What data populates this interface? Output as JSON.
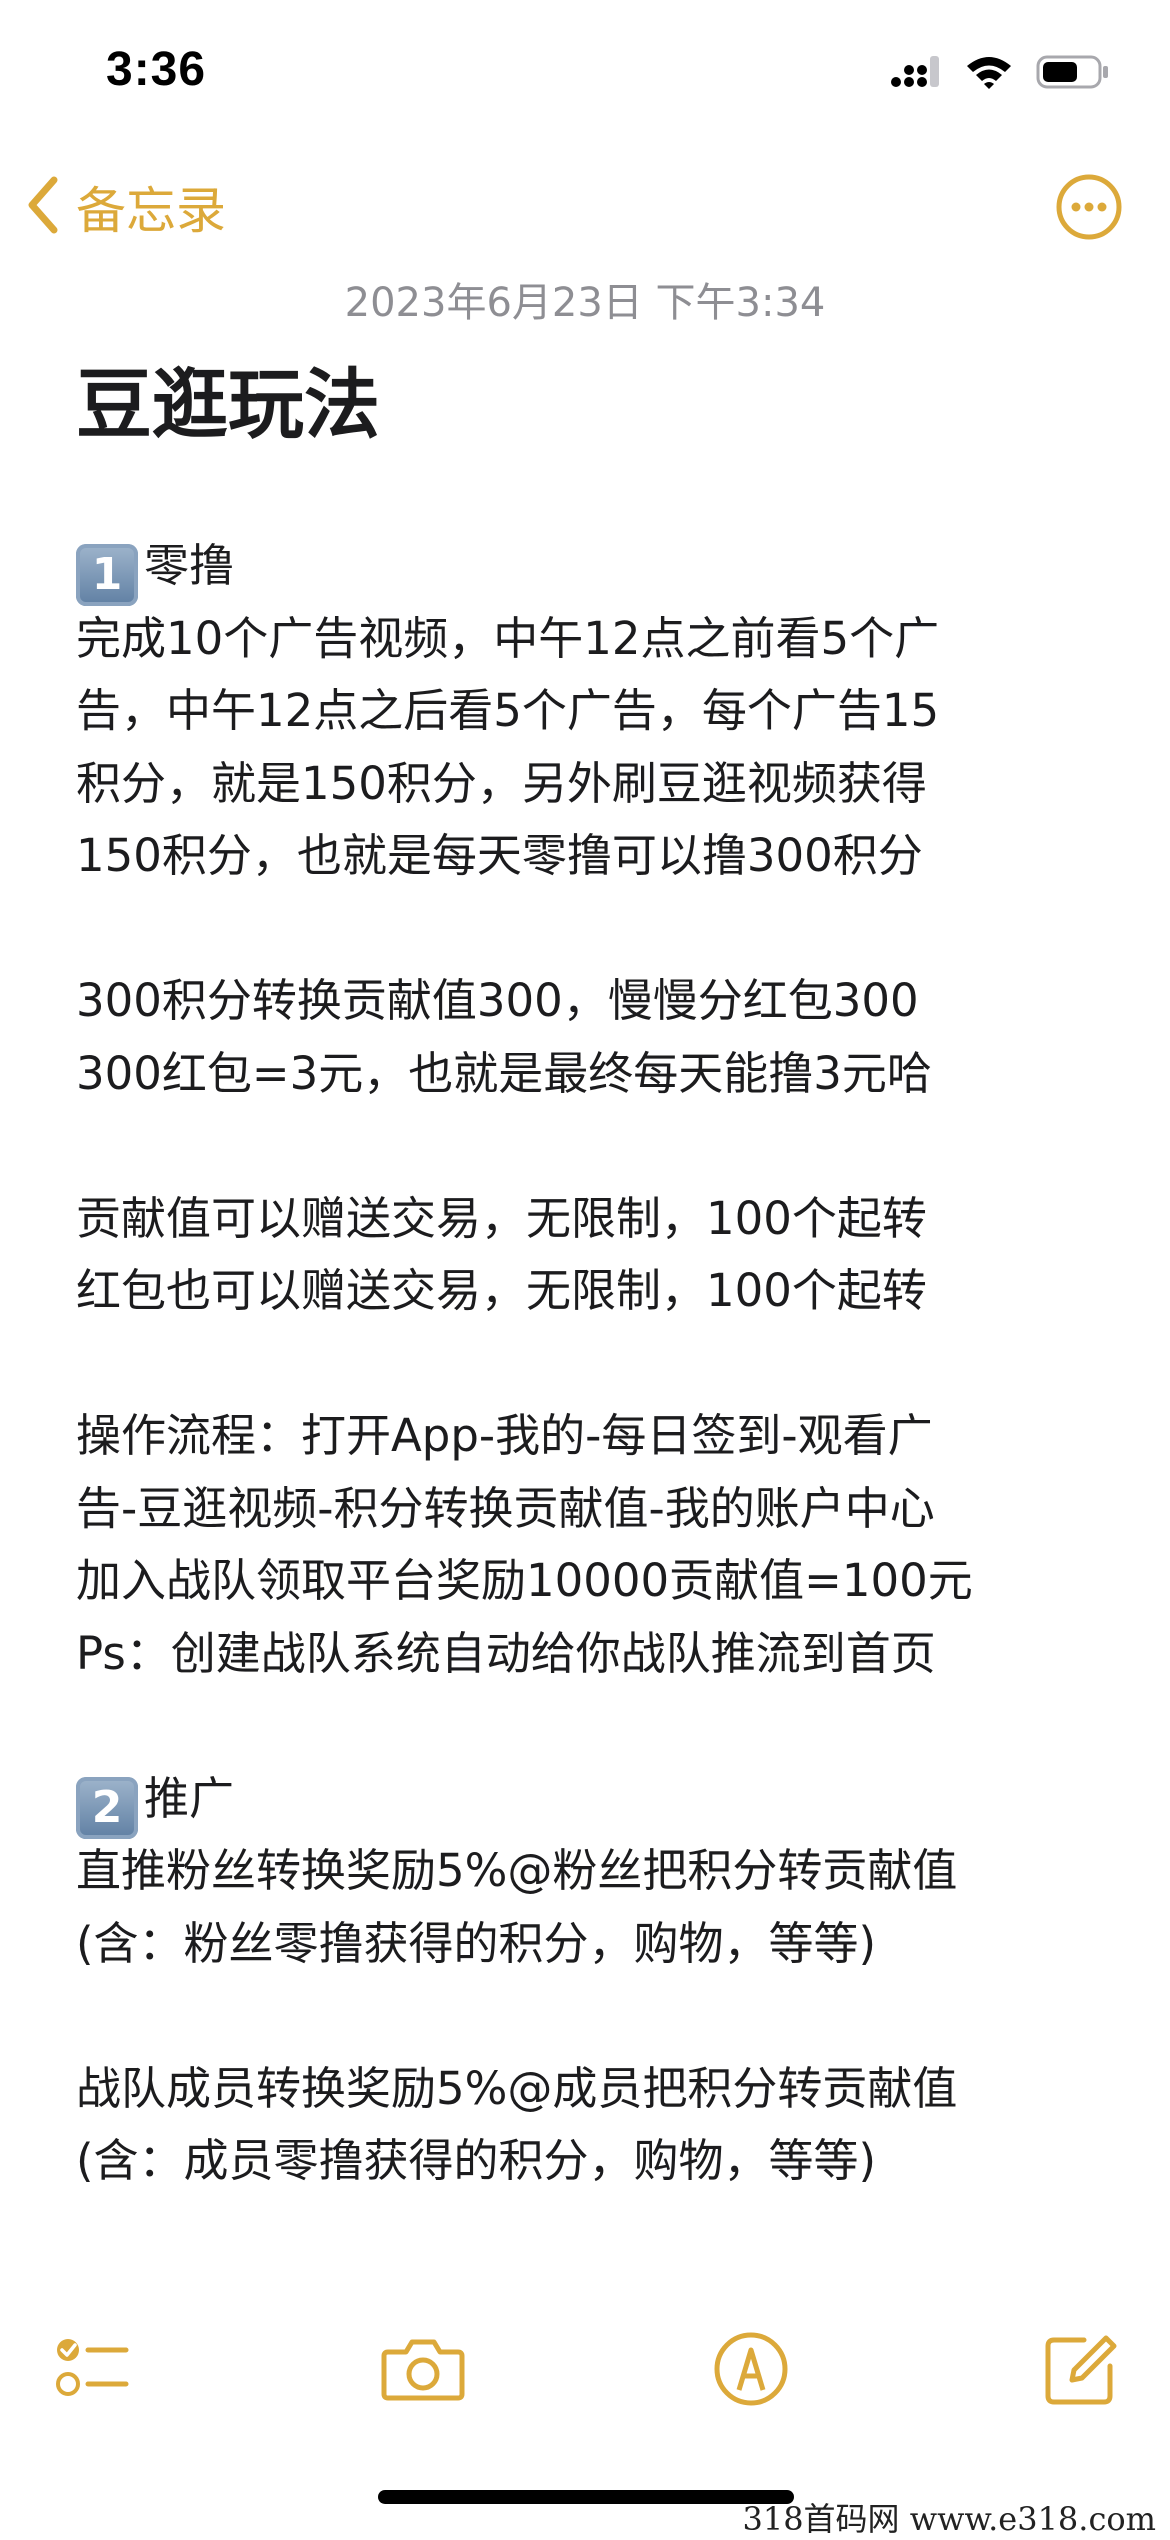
{
  "status_bar": {
    "time": "3:36"
  },
  "nav": {
    "back_label": "备忘录"
  },
  "note": {
    "date": "2023年6月23日 下午3:34",
    "title": "豆逛玩法",
    "lines": [
      {
        "badge": "1",
        "text": "零撸"
      },
      {
        "text": "完成10个广告视频，中午12点之前看5个广"
      },
      {
        "text": "告，中午12点之后看5个广告，每个广告15"
      },
      {
        "text": "积分，就是150积分，另外刷豆逛视频获得"
      },
      {
        "text": "150积分，也就是每天零撸可以撸300积分"
      },
      {
        "text": ""
      },
      {
        "text": "300积分转换贡献值300，慢慢分红包300"
      },
      {
        "text": "300红包=3元，也就是最终每天能撸3元哈"
      },
      {
        "text": ""
      },
      {
        "text": "贡献值可以赠送交易，无限制，100个起转"
      },
      {
        "text": "红包也可以赠送交易，无限制，100个起转"
      },
      {
        "text": ""
      },
      {
        "text": "操作流程：打开App-我的-每日签到-观看广"
      },
      {
        "text": "告-豆逛视频-积分转换贡献值-我的账户中心"
      },
      {
        "text": "加入战队领取平台奖励10000贡献值=100元"
      },
      {
        "text": "Ps：创建战队系统自动给你战队推流到首页"
      },
      {
        "text": ""
      },
      {
        "badge": "2",
        "text": "推广"
      },
      {
        "text": "直推粉丝转换奖励5%@粉丝把积分转贡献值"
      },
      {
        "text": "(含：粉丝零撸获得的积分，购物，等等)"
      },
      {
        "text": ""
      },
      {
        "text": "战队成员转换奖励5%@成员把积分转贡献值"
      },
      {
        "text": "(含：成员零撸获得的积分，购物，等等)"
      }
    ]
  },
  "toolbar": {
    "items": [
      "checklist-icon",
      "camera-icon",
      "markup-pen-icon",
      "compose-icon"
    ]
  },
  "watermark": "318首码网  www.e318.com",
  "colors": {
    "accent": "#dca93a",
    "date_gray": "#8e8e93",
    "text": "#1c1c1e"
  }
}
